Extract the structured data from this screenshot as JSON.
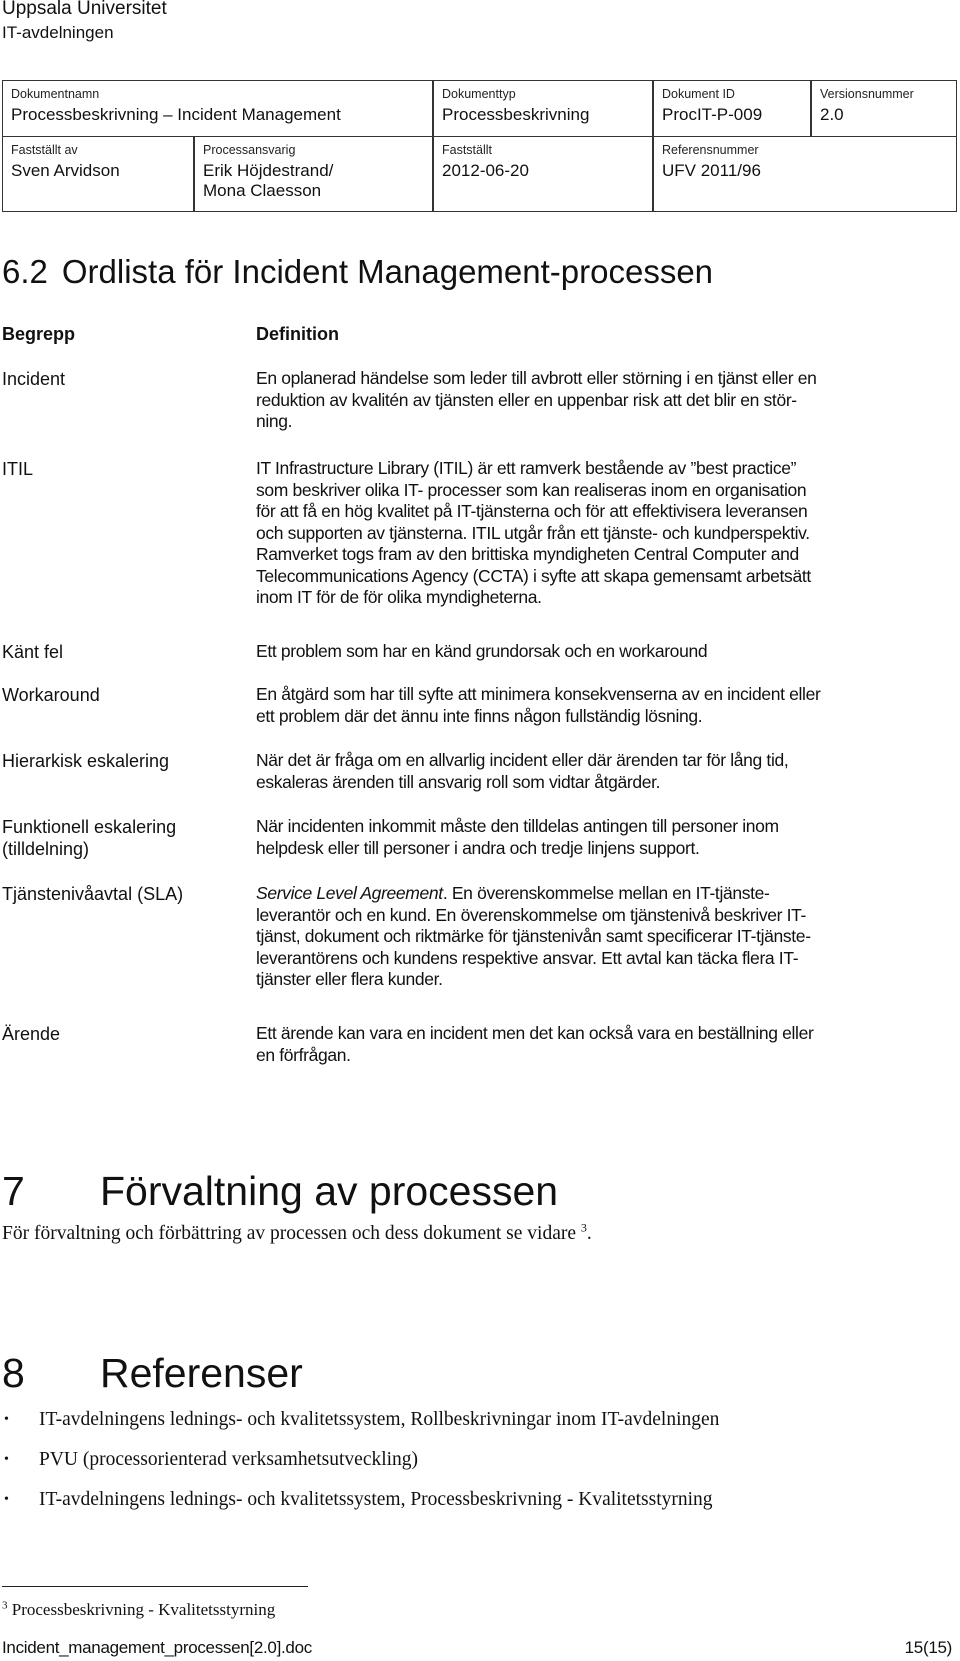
{
  "header": {
    "organization": "Uppsala Universitet",
    "department": "IT-avdelningen"
  },
  "meta_table": {
    "document_name": {
      "label": "Dokumentnamn",
      "value": "Processbeskrivning – Incident Management"
    },
    "document_type": {
      "label": "Dokumenttyp",
      "value": "Processbeskrivning"
    },
    "document_id": {
      "label": "Dokument ID",
      "value": "ProcIT-P-009"
    },
    "version": {
      "label": "Versionsnummer",
      "value": "2.0"
    },
    "approved_by": {
      "label": "Fastställt av",
      "value": "Sven Arvidson"
    },
    "process_owner": {
      "label": "Processansvarig",
      "value_line1": "Erik Höjdestrand/",
      "value_line2": "Mona Claesson"
    },
    "approved_date": {
      "label": "Fastställt",
      "value": "2012-06-20"
    },
    "reference_number": {
      "label": "Referensnummer",
      "value": "UFV 2011/96"
    }
  },
  "glossary": {
    "section_number": "6.2",
    "title": "Ordlista för Incident Management-processen",
    "col_term": "Begrepp",
    "col_definition": "Definition",
    "entries": [
      {
        "term": "Incident",
        "definition": [
          "En oplanerad händelse som leder till avbrott eller störning i en tjänst eller en",
          "reduktion av kvalitén av tjänsten eller en uppenbar risk att det blir en stör-",
          "ning."
        ]
      },
      {
        "term": "ITIL",
        "definition": [
          "IT Infrastructure Library  (ITIL) är ett ramverk bestående av ”best practice”",
          "som beskriver olika IT- processer som kan realiseras inom en organisation",
          "för att få en hög kvalitet på IT-tjänsterna och för att effektivisera leveransen",
          "och supporten av tjänsterna. ITIL utgår från ett tjänste- och kundperspektiv.",
          "Ramverket togs fram av den brittiska myndigheten Central Computer and",
          "Telecommunications Agency (CCTA) i syfte att skapa gemensamt arbetsätt",
          "inom IT för de för olika myndigheterna."
        ]
      },
      {
        "term": "Känt fel",
        "definition": [
          "Ett problem som har en känd grundorsak och en workaround"
        ]
      },
      {
        "term": "Workaround",
        "definition": [
          "En åtgärd som har till syfte att minimera konsekvenserna av en incident eller",
          "ett problem där det ännu inte finns någon fullständig lösning."
        ]
      },
      {
        "term": "Hierarkisk eskalering",
        "definition": [
          "När det är fråga om en allvarlig incident eller där ärenden tar för lång tid,",
          "eskaleras ärenden till ansvarig roll som vidtar åtgärder."
        ]
      },
      {
        "term_line1": "Funktionell eskalering",
        "term_line2": "(tilldelning)",
        "definition": [
          "När incidenten inkommit måste den tilldelas antingen till personer inom",
          "helpdesk eller till personer i andra och tredje linjens support."
        ]
      },
      {
        "term": "Tjänstenivåavtal (SLA)",
        "definition_italic": "Service Level Agreement",
        "definition_first_rest": ". En överenskommelse mellan en IT-tjänste-",
        "definition": [
          "leverantör och en kund. En överenskommelse om tjänstenivå beskriver IT-",
          "tjänst, dokument och riktmärke för tjänstenivån samt specificerar IT-tjänste-",
          "leverantörens och kundens respektive ansvar. Ett avtal kan täcka flera IT-",
          "tjänster eller flera kunder."
        ]
      },
      {
        "term": "Ärende",
        "definition": [
          "Ett ärende kan vara en incident men det kan också vara en beställning eller",
          "en förfrågan."
        ]
      }
    ]
  },
  "section7": {
    "number": "7",
    "title": "Förvaltning av processen",
    "body": "För förvaltning och förbättring av processen och dess dokument se vidare ",
    "footnote_ref": "3",
    "body_end": "."
  },
  "section8": {
    "number": "8",
    "title": "Referenser",
    "bullet_icon": "•",
    "items": [
      "IT-avdelningens lednings- och kvalitetssystem, Rollbeskrivningar inom IT-avdelningen",
      "PVU (processorienterad verksamhetsutveckling)",
      "IT-avdelningens lednings- och kvalitetssystem, Processbeskrivning - Kvalitetsstyrning"
    ]
  },
  "footnote": {
    "marker": "3",
    "text": " Processbeskrivning - Kvalitetsstyrning"
  },
  "footer": {
    "filename": "Incident_management_processen[2.0].doc",
    "page": "15(15)"
  }
}
